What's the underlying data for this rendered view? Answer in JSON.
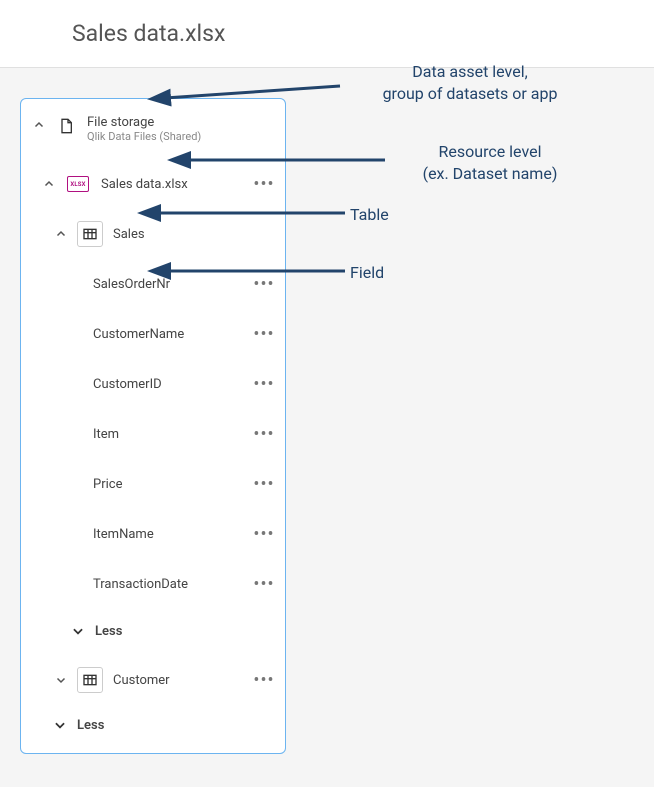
{
  "header": {
    "title": "Sales data.xlsx"
  },
  "panel": {
    "asset": {
      "label": "File storage",
      "sublabel": "Qlik Data Files (Shared)"
    },
    "resource": {
      "label": "Sales data.xlsx"
    },
    "tables": [
      {
        "name": "Sales",
        "expanded": true,
        "fields": [
          "SalesOrderNr",
          "CustomerName",
          "CustomerID",
          "Item",
          "Price",
          "ItemName",
          "TransactionDate"
        ],
        "less": "Less"
      },
      {
        "name": "Customer",
        "expanded": false
      }
    ],
    "outer_less": "Less"
  },
  "annotations": {
    "asset": "Data asset level,\ngroup of datasets or app",
    "resource": "Resource level\n(ex. Dataset name)",
    "table": "Table",
    "field": "Field"
  },
  "colors": {
    "arrow": "#22446b",
    "panel_border": "#6cb4f0"
  }
}
